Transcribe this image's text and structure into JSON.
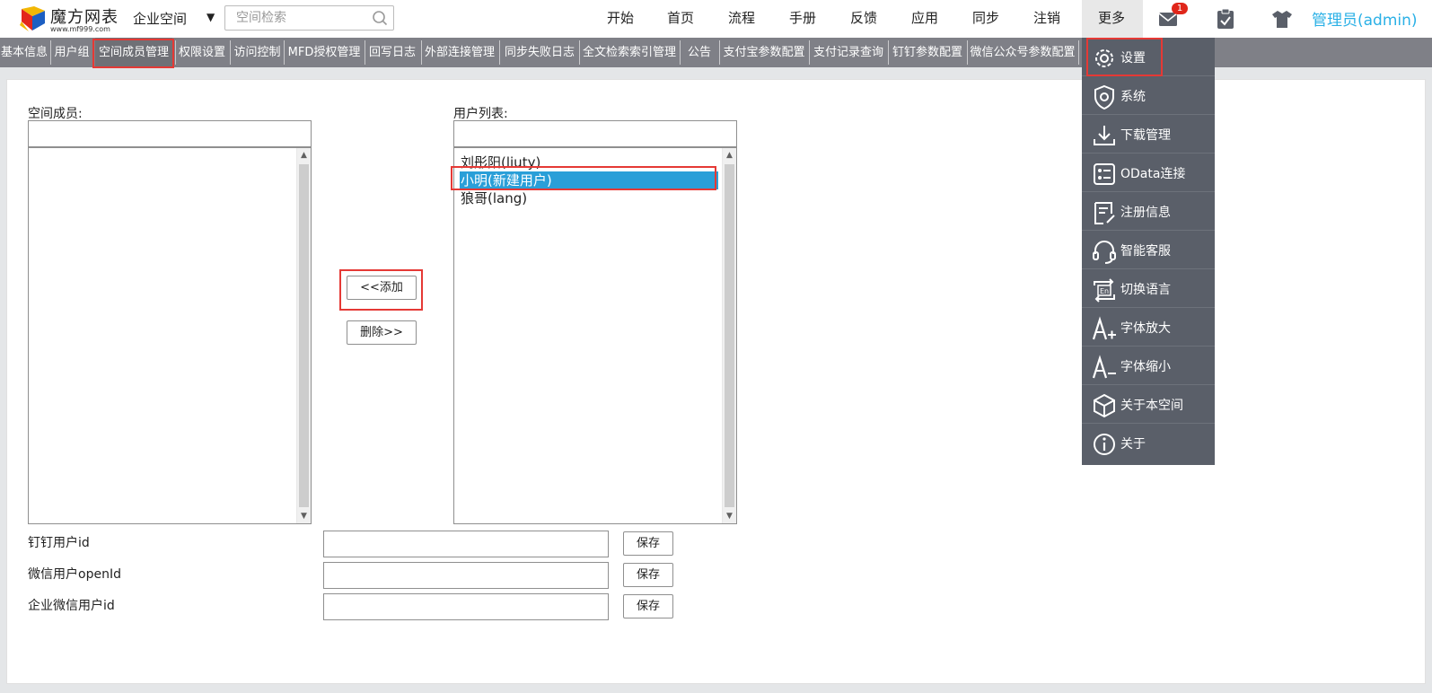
{
  "header": {
    "logo_title": "魔方网表",
    "logo_url": "www.mf999.com",
    "space_selector": "企业空间",
    "search_placeholder": "空间检索",
    "nav": [
      {
        "label": "开始"
      },
      {
        "label": "首页"
      },
      {
        "label": "流程"
      },
      {
        "label": "手册"
      },
      {
        "label": "反馈"
      },
      {
        "label": "应用"
      },
      {
        "label": "同步"
      },
      {
        "label": "注销"
      },
      {
        "label": "更多"
      }
    ],
    "mail_badge": "1",
    "user": "管理员(admin)",
    "icons": [
      "mail-icon",
      "clipboard-icon",
      "shirt-icon"
    ]
  },
  "tabs": [
    {
      "label": "基本信息"
    },
    {
      "label": "用户组"
    },
    {
      "label": "空间成员管理"
    },
    {
      "label": "权限设置"
    },
    {
      "label": "访问控制"
    },
    {
      "label": "MFD授权管理"
    },
    {
      "label": "回写日志"
    },
    {
      "label": "外部连接管理"
    },
    {
      "label": "同步失败日志"
    },
    {
      "label": "全文检索索引管理"
    },
    {
      "label": "公告"
    },
    {
      "label": "支付宝参数配置"
    },
    {
      "label": "支付记录查询"
    },
    {
      "label": "钉钉参数配置"
    },
    {
      "label": "微信公众号参数配置"
    }
  ],
  "active_tab": "空间成员管理",
  "members": {
    "label": "空间成员:",
    "filter_value": "",
    "items": []
  },
  "users": {
    "label": "用户列表:",
    "filter_value": "",
    "items": [
      {
        "label": "刘彤阳(liuty)"
      },
      {
        "label": "小明(新建用户)"
      },
      {
        "label": "狼哥(lang)"
      }
    ],
    "selected": "小明(新建用户)"
  },
  "buttons": {
    "add": "<<添加",
    "remove": "删除>>"
  },
  "fields": [
    {
      "label": "钉钉用户id",
      "value": "",
      "save": "保存"
    },
    {
      "label": "微信用户openId",
      "value": "",
      "save": "保存"
    },
    {
      "label": "企业微信用户id",
      "value": "",
      "save": "保存"
    }
  ],
  "dropdown": [
    {
      "label": "设置",
      "icon": "gear-icon"
    },
    {
      "label": "系统",
      "icon": "shield-gear-icon"
    },
    {
      "label": "下载管理",
      "icon": "download-icon"
    },
    {
      "label": "OData连接",
      "icon": "odata-icon"
    },
    {
      "label": "注册信息",
      "icon": "register-doc-icon"
    },
    {
      "label": "智能客服",
      "icon": "headset-icon"
    },
    {
      "label": "切换语言",
      "icon": "language-switch-icon"
    },
    {
      "label": "字体放大",
      "icon": "font-increase-icon"
    },
    {
      "label": "字体缩小",
      "icon": "font-decrease-icon"
    },
    {
      "label": "关于本空间",
      "icon": "cube-icon"
    },
    {
      "label": "关于",
      "icon": "info-icon"
    }
  ],
  "colors": {
    "accent_blue": "#2ab0e6",
    "selection": "#2a9fd8",
    "tabbar": "#7f8087",
    "dropdown": "#5a5f69",
    "highlight_red": "#e53935",
    "badge_red": "#e0261a"
  }
}
